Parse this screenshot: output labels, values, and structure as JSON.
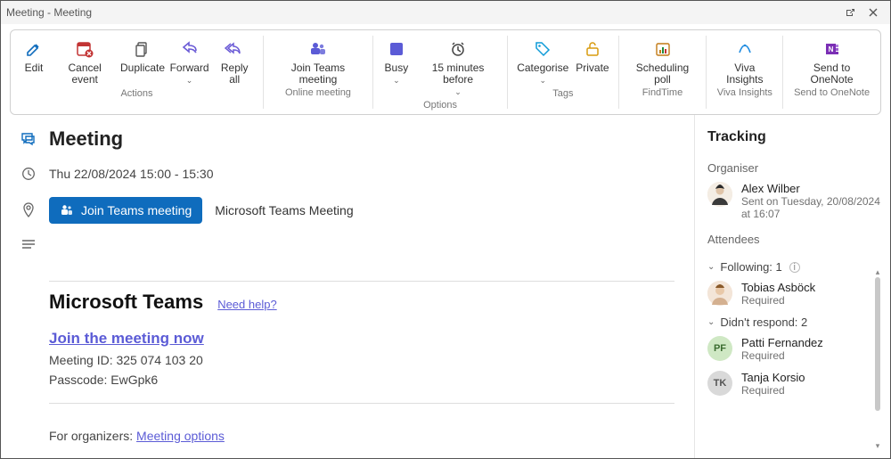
{
  "window": {
    "title": "Meeting - Meeting"
  },
  "ribbon": {
    "edit": "Edit",
    "cancel": "Cancel event",
    "duplicate": "Duplicate",
    "forward": "Forward",
    "replyall": "Reply all",
    "actions_group": "Actions",
    "joinTeams": "Join Teams meeting",
    "online_group": "Online meeting",
    "busy": "Busy",
    "reminder": "15 minutes before",
    "options_group": "Options",
    "categorise": "Categorise",
    "private": "Private",
    "tags_group": "Tags",
    "schedPoll": "Scheduling poll",
    "findtime_group": "FindTime",
    "viva": "Viva Insights",
    "viva_group": "Viva Insights",
    "onenote": "Send to OneNote",
    "onenote_group": "Send to OneNote"
  },
  "meeting": {
    "subject": "Meeting",
    "datetime": "Thu 22/08/2024 15:00 - 15:30",
    "join_button": "Join Teams meeting",
    "location": "Microsoft Teams Meeting"
  },
  "body_content": {
    "teams_title": "Microsoft Teams",
    "help_link": "Need help?",
    "join_now": "Join the meeting now",
    "meeting_id_label": "Meeting ID:",
    "meeting_id": "325 074 103 20",
    "passcode_label": "Passcode:",
    "passcode": "EwGpk6",
    "organizers_prefix": "For organizers:",
    "options_link": "Meeting options"
  },
  "tracking": {
    "heading": "Tracking",
    "organiser_label": "Organiser",
    "organiser": {
      "name": "Alex Wilber",
      "sent": "Sent on Tuesday, 20/08/2024 at 16:07"
    },
    "attendees_label": "Attendees",
    "following_label": "Following: 1",
    "following": [
      {
        "name": "Tobias Asböck",
        "status": "Required",
        "avatar_bg": "#f3e5d8",
        "avatar_type": "photo"
      }
    ],
    "didnt_label": "Didn't respond: 2",
    "didnt": [
      {
        "name": "Patti Fernandez",
        "status": "Required",
        "initials": "PF",
        "avatar_bg": "#cfe8c4"
      },
      {
        "name": "Tanja Korsio",
        "status": "Required",
        "initials": "TK",
        "avatar_bg": "#d9d9d9"
      }
    ]
  }
}
